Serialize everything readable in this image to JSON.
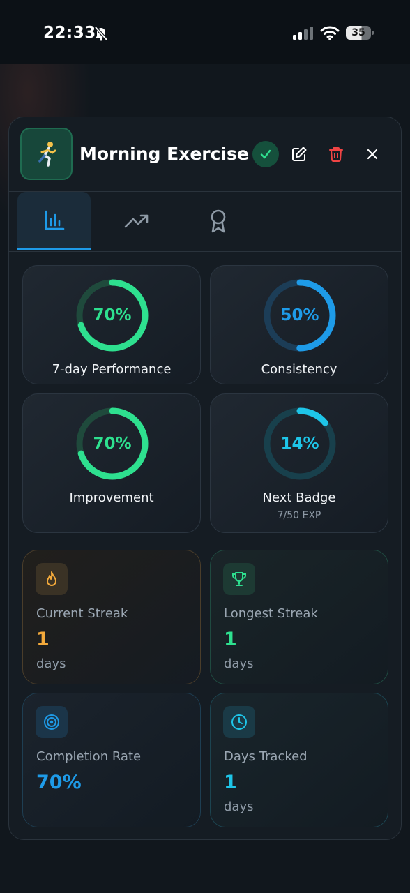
{
  "status_bar": {
    "time": "22:33",
    "battery": "35"
  },
  "habit": {
    "title": "Morning Exercise",
    "emoji": "🏃"
  },
  "tabs": [
    {
      "name": "bar-chart-icon",
      "active": true
    },
    {
      "name": "trending-up-icon",
      "active": false
    },
    {
      "name": "award-icon",
      "active": false
    }
  ],
  "metrics": [
    {
      "label": "7-day Performance",
      "value_text": "70%",
      "value": 70,
      "color": "#2ee08f",
      "track": "#1f4a3c"
    },
    {
      "label": "Consistency",
      "value_text": "50%",
      "value": 50,
      "color": "#1e9be8",
      "track": "#1c3d57"
    },
    {
      "label": "Improvement",
      "value_text": "70%",
      "value": 70,
      "color": "#2ee08f",
      "track": "#1f4a3c"
    },
    {
      "label": "Next Badge",
      "value_text": "14%",
      "value": 14,
      "sub": "7/50 EXP",
      "color": "#1ec5e8",
      "track": "#18404c"
    }
  ],
  "stats": {
    "current_streak": {
      "label": "Current Streak",
      "value": "1",
      "unit": "days",
      "color": "#f2a93b"
    },
    "longest_streak": {
      "label": "Longest Streak",
      "value": "1",
      "unit": "days",
      "color": "#2ee08f"
    },
    "completion_rate": {
      "label": "Completion Rate",
      "value": "70%",
      "color": "#1e9be8"
    },
    "days_tracked": {
      "label": "Days Tracked",
      "value": "1",
      "unit": "days",
      "color": "#1ec5e8"
    }
  }
}
